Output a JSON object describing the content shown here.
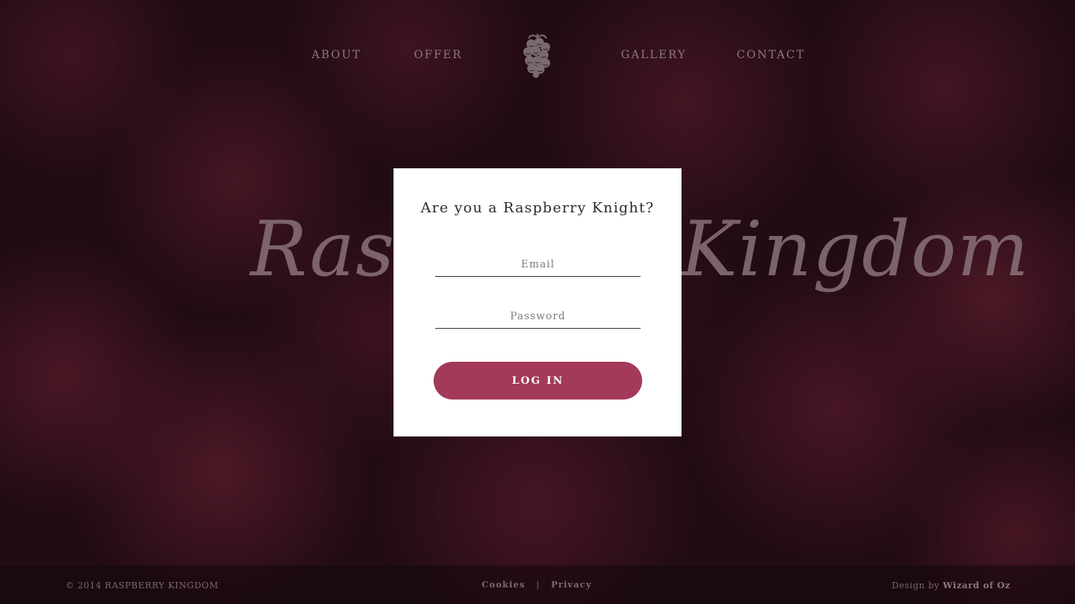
{
  "nav": {
    "items": [
      {
        "label": "ABOUT"
      },
      {
        "label": "OFFER"
      },
      {
        "label": "GALLERY"
      },
      {
        "label": "CONTACT"
      }
    ],
    "logo_icon": "raspberry-logo-icon"
  },
  "hero": {
    "title": "Raspberry Kingdom"
  },
  "login": {
    "title": "Are you a Raspberry Knight?",
    "email_placeholder": "Email",
    "password_placeholder": "Password",
    "button_label": "LOG IN"
  },
  "footer": {
    "copyright": "© 2014 RASPBERRY KINGDOM",
    "cookies": "Cookies",
    "separator": "|",
    "privacy": "Privacy",
    "credit_prefix": "Design by",
    "credit_name": "Wizard of Oz"
  },
  "colors": {
    "accent": "#a33a5a",
    "card": "#ffffff",
    "nav_text": "#8a7a80"
  }
}
